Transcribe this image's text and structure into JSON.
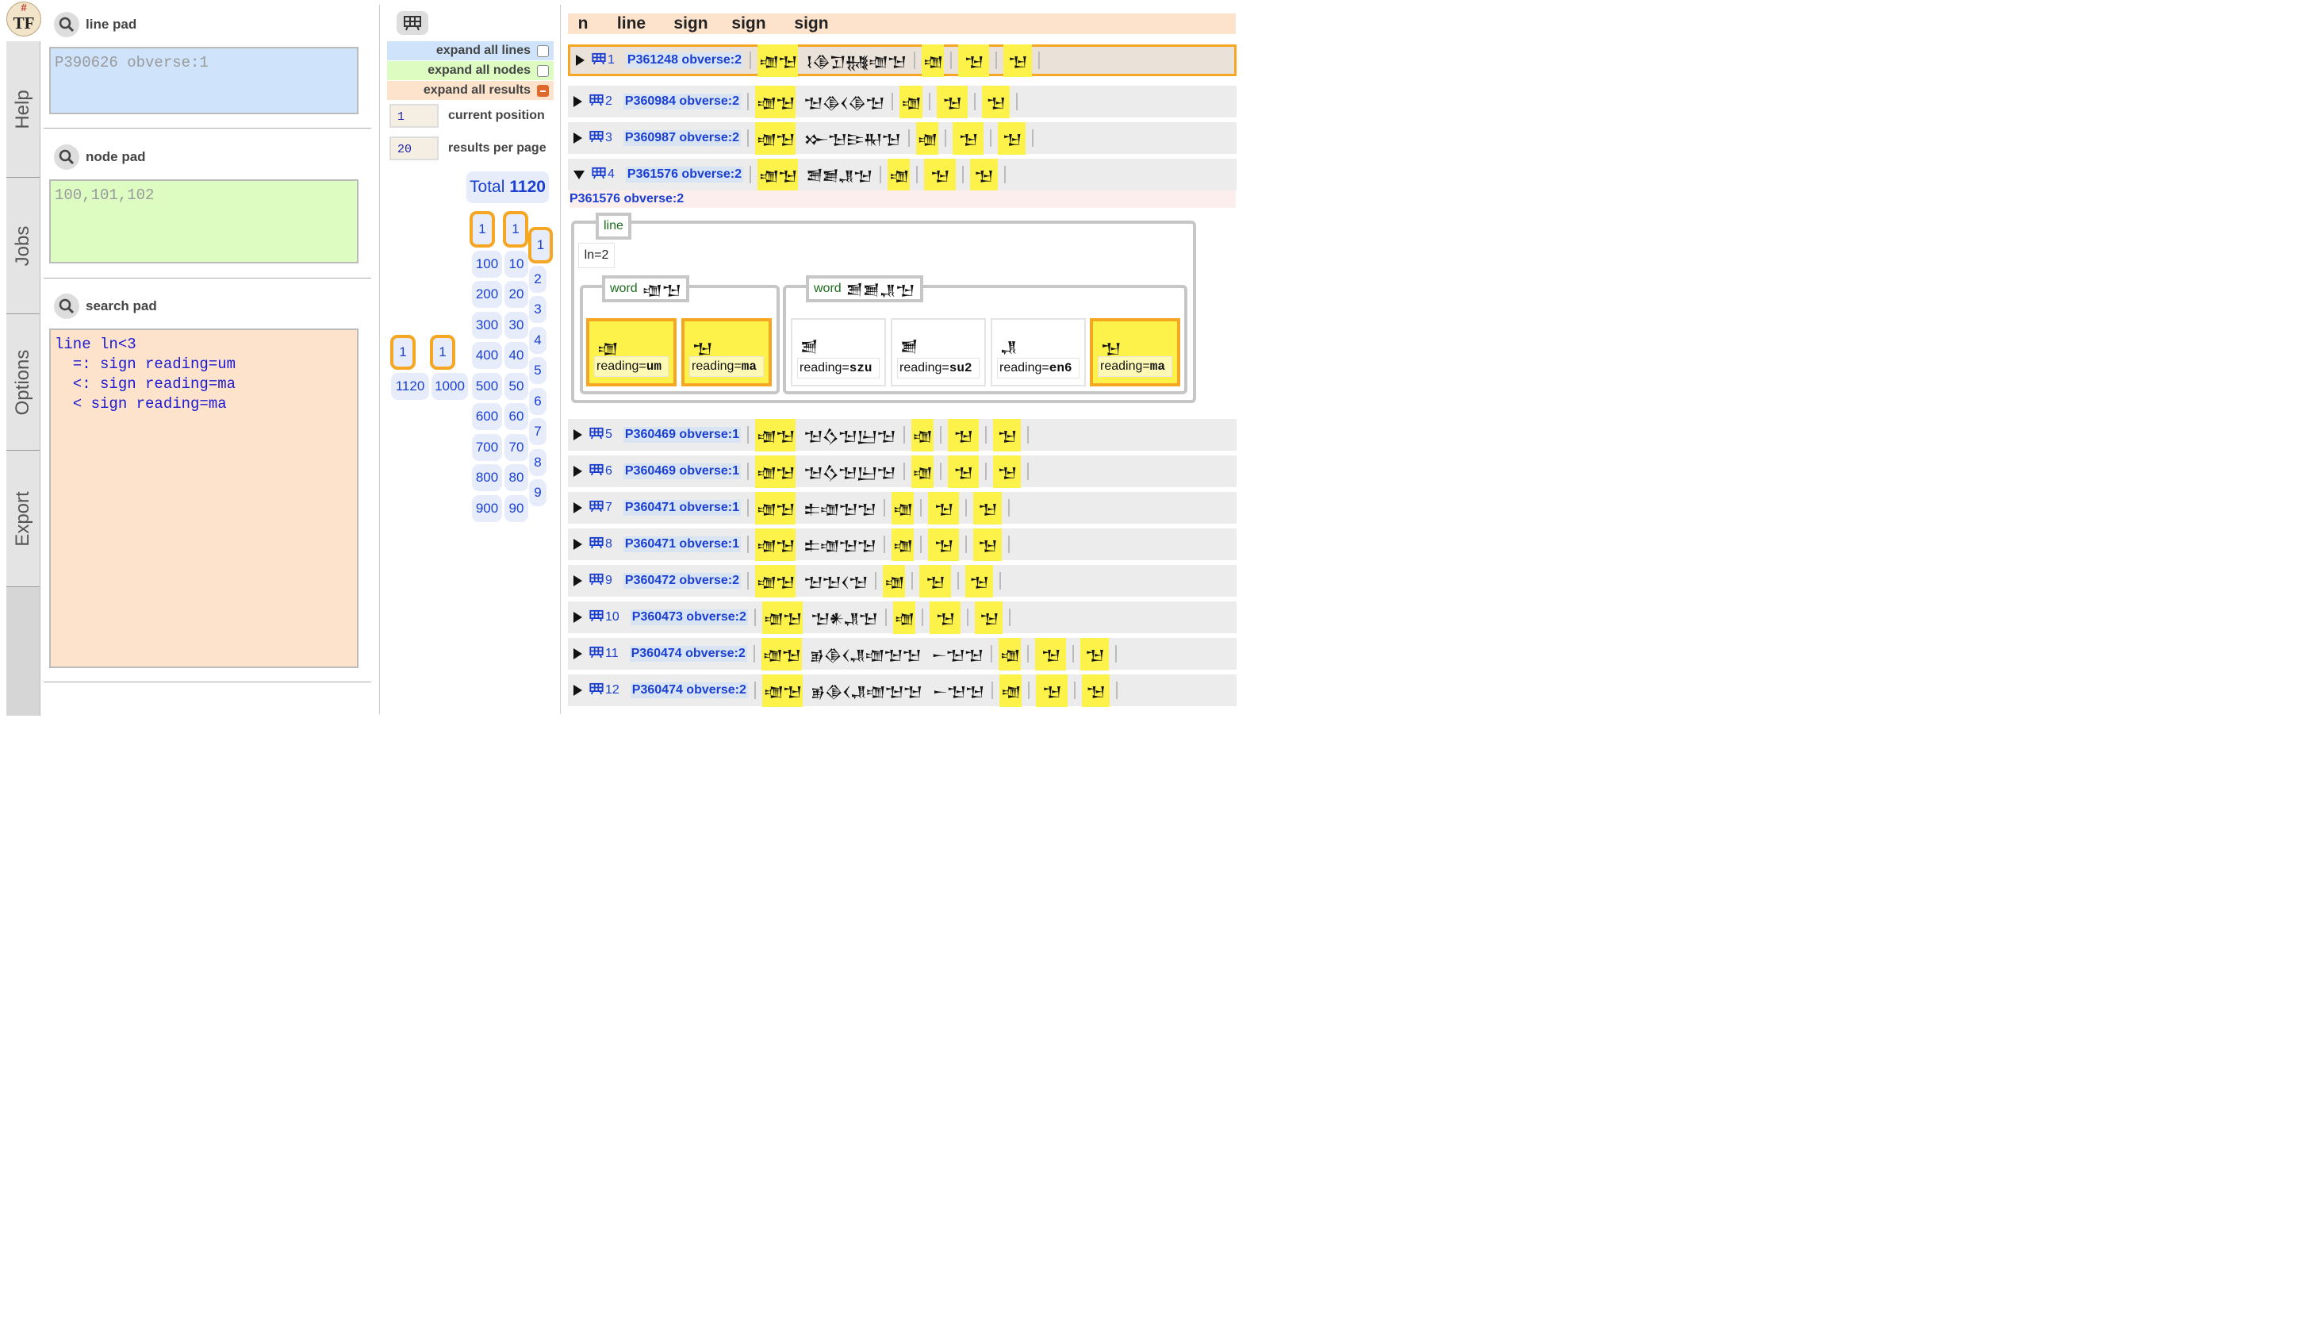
{
  "logo": {
    "hash": "#",
    "letters": "TF"
  },
  "tabs": [
    "Help",
    "Jobs",
    "Options",
    "Export"
  ],
  "pads": {
    "line": {
      "label": "line pad",
      "value": "P390626 obverse:1"
    },
    "node": {
      "label": "node pad",
      "value": "100,101,102"
    },
    "search": {
      "label": "search pad",
      "value": "line ln<3\n  =: sign reading=um\n  <: sign reading=ma\n  < sign reading=ma"
    }
  },
  "controls": {
    "expand_lines": "expand all lines",
    "expand_nodes": "expand all nodes",
    "expand_results": "expand all results",
    "current_position_value": "1",
    "current_position_label": "current position",
    "per_page_value": "20",
    "per_page_label": "results per page",
    "total_label": "Total",
    "total_value": "1120"
  },
  "nav": {
    "col_thousands": [
      "1",
      "1120"
    ],
    "col_thousands2": [
      "1",
      "1000"
    ],
    "col_hundreds": [
      "1",
      "100",
      "200",
      "300",
      "400",
      "500",
      "600",
      "700",
      "800",
      "900"
    ],
    "col_tens": [
      "1",
      "10",
      "20",
      "30",
      "40",
      "50",
      "60",
      "70",
      "80",
      "90"
    ],
    "col_units": [
      "1",
      "2",
      "3",
      "4",
      "5",
      "6",
      "7",
      "8",
      "9"
    ]
  },
  "headers": [
    "n",
    "line",
    "sign",
    "sign",
    "sign"
  ],
  "results": [
    {
      "n": "1",
      "line": "P361248 obverse:2",
      "w1": "𒌝𒈠",
      "w2": "𒋙𒆠𒋛𒉆𒌝𒈠",
      "s1": "𒌝",
      "s2": "𒈠",
      "s3": "𒈠"
    },
    {
      "n": "2",
      "line": "P360984 obverse:2",
      "w1": "𒌝𒈠",
      "w2": "𒈠𒆠𒌋𒆠𒈠",
      "s1": "𒌝",
      "s2": "𒈠",
      "s3": "𒈠"
    },
    {
      "n": "3",
      "line": "P360987 obverse:2",
      "w1": "𒌝𒈠",
      "w2": "𒁍𒈠𒄿𒊑𒈠",
      "s1": "𒌝",
      "s2": "𒈠",
      "s3": "𒈠"
    },
    {
      "n": "4",
      "line": "P361576 obverse:2",
      "w1": "𒌝𒈠",
      "w2": "𒍪𒋢𒂗𒈠",
      "s1": "𒌝",
      "s2": "𒈠",
      "s3": "𒈠"
    },
    {
      "n": "5",
      "line": "P360469 obverse:1",
      "w1": "𒌝𒈠",
      "w2": "𒈠𒋝𒈠𒌨𒈠",
      "s1": "𒌝",
      "s2": "𒈠",
      "s3": "𒈠"
    },
    {
      "n": "6",
      "line": "P360469 obverse:1",
      "w1": "𒌝𒈠",
      "w2": "𒈠𒋝𒈠𒌨𒈠",
      "s1": "𒌝",
      "s2": "𒈠",
      "s3": "𒈠"
    },
    {
      "n": "7",
      "line": "P360471 obverse:1",
      "w1": "𒌝𒈠",
      "w2": "𒉺𒌝𒈠𒈠",
      "s1": "𒌝",
      "s2": "𒈠",
      "s3": "𒈠"
    },
    {
      "n": "8",
      "line": "P360471 obverse:1",
      "w1": "𒌝𒈠",
      "w2": "𒉺𒌝𒈠𒈠",
      "s1": "𒌝",
      "s2": "𒈠",
      "s3": "𒈠"
    },
    {
      "n": "9",
      "line": "P360472 obverse:2",
      "w1": "𒌝𒈠",
      "w2": "𒈠𒈠𒌋𒈠",
      "s1": "𒌝",
      "s2": "𒈠",
      "s3": "𒈠"
    },
    {
      "n": "10",
      "line": "P360473 obverse:2",
      "w1": "𒌝𒈠",
      "w2": "𒈠𒀭𒂗𒈠",
      "s1": "𒌝",
      "s2": "𒈠",
      "s3": "𒈠"
    },
    {
      "n": "11",
      "line": "P360474 obverse:2",
      "w1": "𒌝𒈠",
      "w2": "𒂊𒆠𒌋𒂗𒌝𒈠𒈠",
      "w3": "𒀸𒈠𒈠",
      "s1": "𒌝",
      "s2": "𒈠",
      "s3": "𒈠"
    },
    {
      "n": "12",
      "line": "P360474 obverse:2",
      "w1": "𒌝𒈠",
      "w2": "𒂊𒆠𒌋𒂗𒌝𒈠𒈠",
      "w3": "𒀸𒈠𒈠",
      "s1": "𒌝",
      "s2": "𒈠",
      "s3": "𒈠"
    }
  ],
  "expanded": {
    "title": "P361576 obverse:2",
    "line_tag": "line",
    "ln": "ln=2",
    "word1_tag": "word",
    "word1_glyph": "𒌝𒈠",
    "word2_tag": "word",
    "word2_glyph": "𒍪𒋢𒂗𒈠",
    "signs": [
      {
        "glyph": "𒌝",
        "key": "reading=",
        "val": "um"
      },
      {
        "glyph": "𒈠",
        "key": "reading=",
        "val": "ma"
      },
      {
        "glyph": "𒍪",
        "key": "reading=",
        "val": "szu"
      },
      {
        "glyph": "𒋢",
        "key": "reading=",
        "val": "su2"
      },
      {
        "glyph": "𒂗",
        "key": "reading=",
        "val": "en6"
      },
      {
        "glyph": "𒈠",
        "key": "reading=",
        "val": "ma"
      }
    ]
  },
  "colors": {
    "accent": "#f5a623",
    "link": "#1a3fd1",
    "highlight": "#fdf24a",
    "linepad": "#cfe4fb",
    "nodepad": "#dcfcc2",
    "searchpad": "#fde2cc"
  }
}
